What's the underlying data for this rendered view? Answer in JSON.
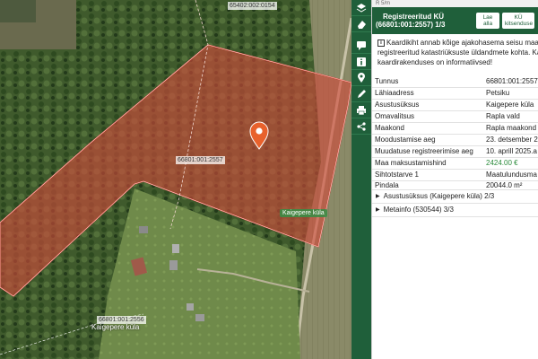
{
  "map": {
    "parcel_main_label": "66801:001:2557",
    "parcel_top_label": "65402:002:0154",
    "parcel_bottom_label": "66801:001:2556",
    "village_label": "Kaigepere küla",
    "bottom_text": "Kaigepere küla",
    "pin_icon": "location-pin-icon",
    "highlight_color": "#d24a3c"
  },
  "toolbar": {
    "tools": [
      {
        "name": "layers-tool",
        "icon": "layers-icon"
      },
      {
        "name": "eraser-tool",
        "icon": "eraser-icon"
      },
      {
        "name": "comment-tool",
        "icon": "comment-icon"
      },
      {
        "name": "info-tool",
        "icon": "info-icon"
      },
      {
        "name": "location-tool",
        "icon": "location-icon"
      },
      {
        "name": "measure-tool",
        "icon": "pencil-icon"
      },
      {
        "name": "print-tool",
        "icon": "print-icon"
      },
      {
        "name": "share-tool",
        "icon": "share-icon"
      }
    ]
  },
  "panel": {
    "scale": "R 5/m",
    "title_line1": "Registreeritud KÜ",
    "title_line2": "(66801:001:2557) 1/3",
    "btn_download": "Lae alla",
    "btn_owners": "KÜ kitsenduse",
    "notice": [
      "Kaardikiht annab kõige ajakohasema seisu maaka",
      "registreeritud katastriüksuste üldandmete kohta. Katas",
      "kaardirakenduses on informatiivsed!"
    ],
    "attributes": [
      {
        "key": "Tunnus",
        "value": "66801:001:2557"
      },
      {
        "key": "Lähiaadress",
        "value": "Petsiku"
      },
      {
        "key": "Asustusüksus",
        "value": "Kaigepere küla"
      },
      {
        "key": "Omavalitsus",
        "value": "Rapla vald"
      },
      {
        "key": "Maakond",
        "value": "Rapla maakond"
      },
      {
        "key": "Moodustamise aeg",
        "value": "23. detsember 2"
      },
      {
        "key": "Muudatuse registreerimise aeg",
        "value": "10. aprill 2025.a"
      },
      {
        "key": "Maa maksustamishind",
        "value": "2424.00 €"
      },
      {
        "key": "Sihtotstarve 1",
        "value": "Maatulundusma"
      },
      {
        "key": "Pindala",
        "value": "20044.0 m²"
      }
    ],
    "sections": [
      {
        "label": "Asustusüksus (Kaigepere küla) 2/3"
      },
      {
        "label": "Metainfo (530544) 3/3"
      }
    ],
    "value_green_color": "#2a8a3a"
  }
}
